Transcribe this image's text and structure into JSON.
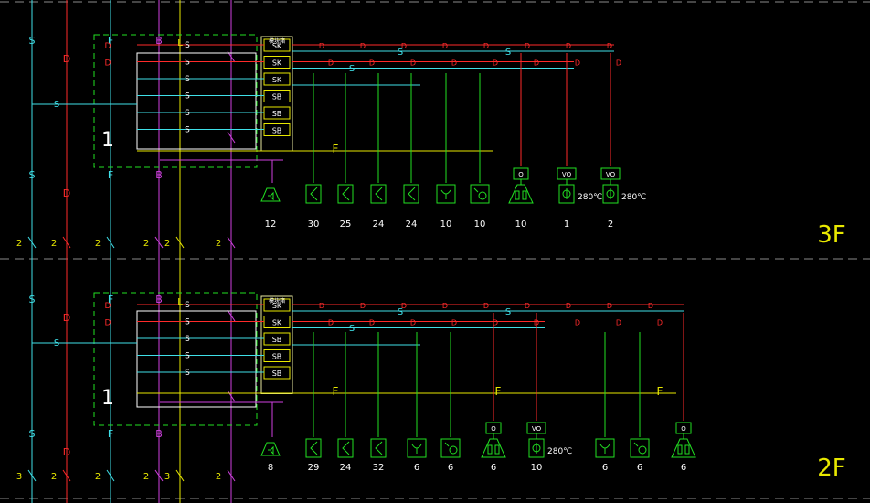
{
  "colors": {
    "background": "#000000",
    "cyan": "#3fe0e8",
    "red": "#ff2a2a",
    "green": "#22e022",
    "yellow": "#e8e800",
    "magenta": "#d040e0",
    "white": "#ffffff",
    "dashed_divider": "#8a8a8a",
    "module_box": "#e8e8a0"
  },
  "floors": [
    {
      "floor_label": "3F",
      "main_trunks": {
        "s": "S",
        "d": "D",
        "f": "F",
        "b": "B"
      },
      "riser_counts": [
        "2",
        "2",
        "2",
        "2",
        "2",
        "2"
      ],
      "panel_number": "1",
      "module_header": "模块箱",
      "modules": [
        "SK",
        "SK",
        "SK",
        "SB",
        "SB",
        "SB"
      ],
      "junction_labels": {
        "s": "S",
        "f": "F"
      },
      "devices": [
        {
          "icon": "speaker",
          "count": "12"
        },
        {
          "icon": "smoke",
          "count": "30"
        },
        {
          "icon": "smoke",
          "count": "25"
        },
        {
          "icon": "smoke",
          "count": "24"
        },
        {
          "icon": "smoke",
          "count": "24"
        },
        {
          "icon": "heat",
          "count": "10"
        },
        {
          "icon": "beam",
          "count": "10"
        },
        {
          "icon": "manual-alarm",
          "count": "10",
          "tag": "O"
        },
        {
          "icon": "valve",
          "count": "1",
          "tag": "VO",
          "note": "280℃"
        },
        {
          "icon": "valve",
          "count": "2",
          "tag": "VO",
          "note": "280℃"
        }
      ]
    },
    {
      "floor_label": "2F",
      "main_trunks": {
        "s": "S",
        "d": "D",
        "f": "F",
        "b": "B"
      },
      "riser_counts": [
        "3",
        "2",
        "2",
        "2",
        "3",
        "2"
      ],
      "panel_number": "1",
      "module_header": "模块箱",
      "modules": [
        "SK",
        "SK",
        "SB",
        "SB",
        "SB"
      ],
      "junction_labels": {
        "s": "S",
        "f": "F"
      },
      "devices": [
        {
          "icon": "speaker",
          "count": "8"
        },
        {
          "icon": "smoke",
          "count": "29"
        },
        {
          "icon": "smoke",
          "count": "24"
        },
        {
          "icon": "smoke",
          "count": "32"
        },
        {
          "icon": "heat",
          "count": "6"
        },
        {
          "icon": "beam",
          "count": "6"
        },
        {
          "icon": "manual-alarm",
          "count": "6",
          "tag": "O"
        },
        {
          "icon": "valve",
          "count": "10",
          "tag": "VO",
          "note": "280℃"
        },
        {
          "icon": "heat",
          "count": "6"
        },
        {
          "icon": "beam",
          "count": "6"
        },
        {
          "icon": "manual-alarm",
          "count": "6",
          "tag": "O"
        }
      ]
    }
  ]
}
